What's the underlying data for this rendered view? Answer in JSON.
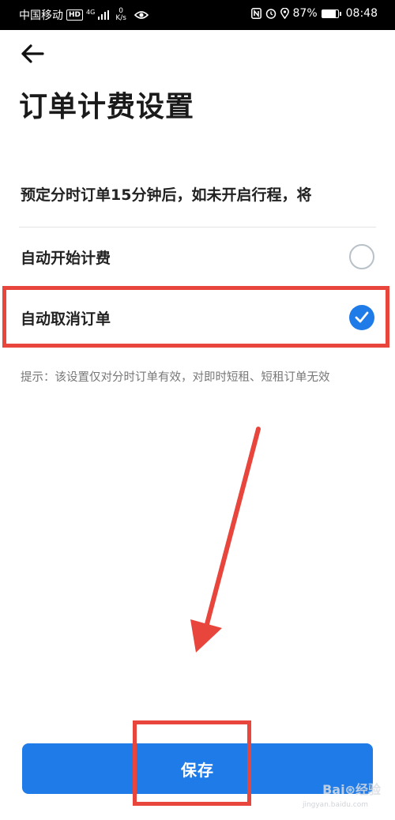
{
  "status_bar": {
    "carrier": "中国移动",
    "hd_badge": "HD",
    "network": "4G",
    "speed_value": "0",
    "speed_unit": "K/s",
    "battery_percent": "87%",
    "battery_level": 0.87,
    "time": "08:48"
  },
  "header": {
    "title": "订单计费设置"
  },
  "settings": {
    "prompt": "预定分时订单15分钟后，如未开启行程，将",
    "options": [
      {
        "label": "自动开始计费",
        "selected": false
      },
      {
        "label": "自动取消订单",
        "selected": true
      }
    ],
    "hint": "提示：该设置仅对分时订单有效，对即时短租、短租订单无效"
  },
  "footer": {
    "save_label": "保存"
  },
  "watermark": {
    "text": "Bai⊛经验",
    "sub": "jingyan.baidu.com"
  },
  "colors": {
    "accent": "#1e7be8",
    "annotation_red": "#e8453c",
    "radio_off": "#b8c0c8"
  }
}
